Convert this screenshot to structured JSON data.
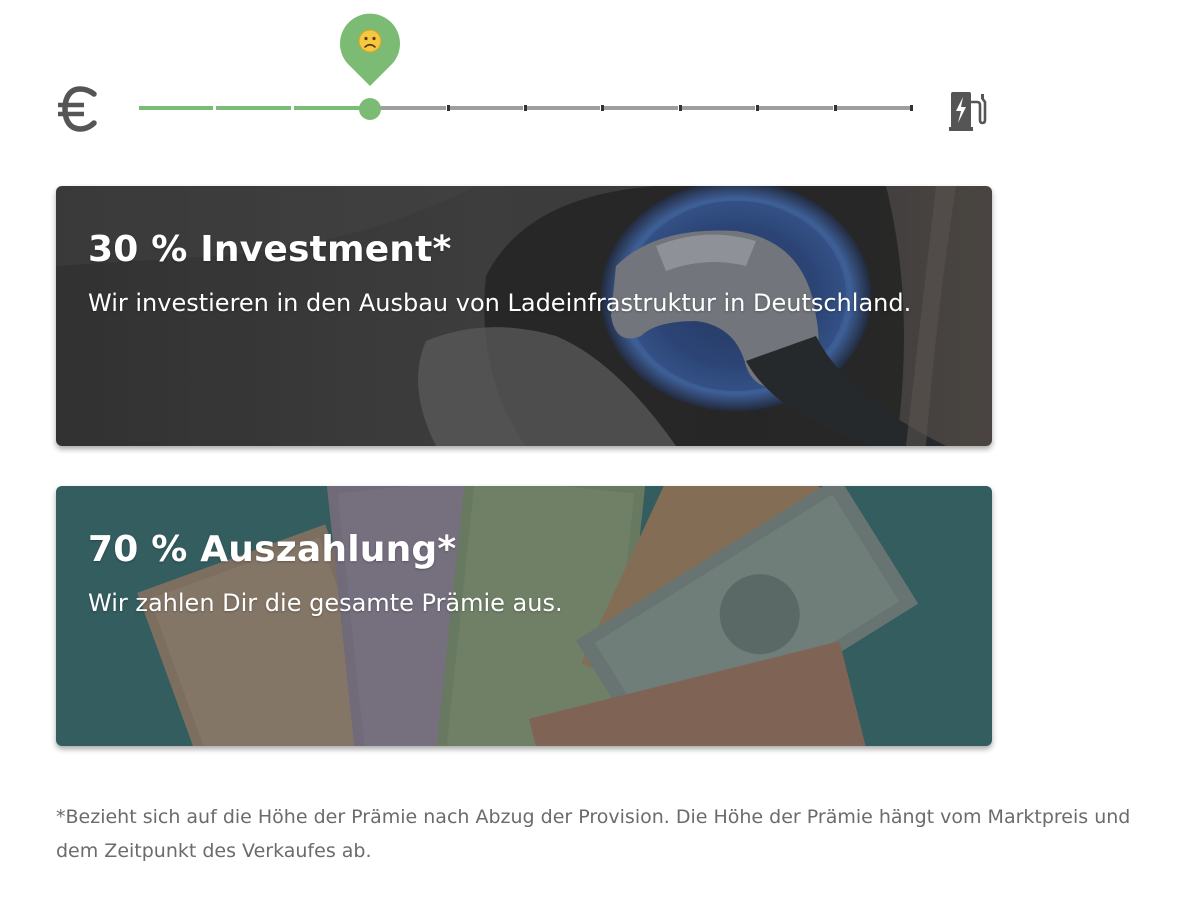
{
  "slider": {
    "left_icon": "euro-icon",
    "right_icon": "ev-charging-station-icon",
    "thumb_icon": "frowning-face-icon",
    "steps": 10,
    "selected_step": 3,
    "colors": {
      "active": "#7cbb74",
      "inactive": "#9e9e9e",
      "tick": "#333333",
      "icon": "#555555"
    }
  },
  "cards": {
    "investment": {
      "title": "30 % Investment*",
      "description": "Wir investieren in den Ausbau von Ladeinfrastruktur in Deutschland.",
      "background": "ev-charging-plug-photo"
    },
    "payout": {
      "title": "70 % Auszahlung*",
      "description": "Wir zahlen Dir die gesamte Prämie aus.",
      "background": "euro-and-dollar-banknotes-photo"
    }
  },
  "footnote": "*Bezieht sich auf die Höhe der Prämie nach Abzug der Provision. Die Höhe der Prämie hängt vom Marktpreis und dem Zeitpunkt des Verkaufes ab."
}
